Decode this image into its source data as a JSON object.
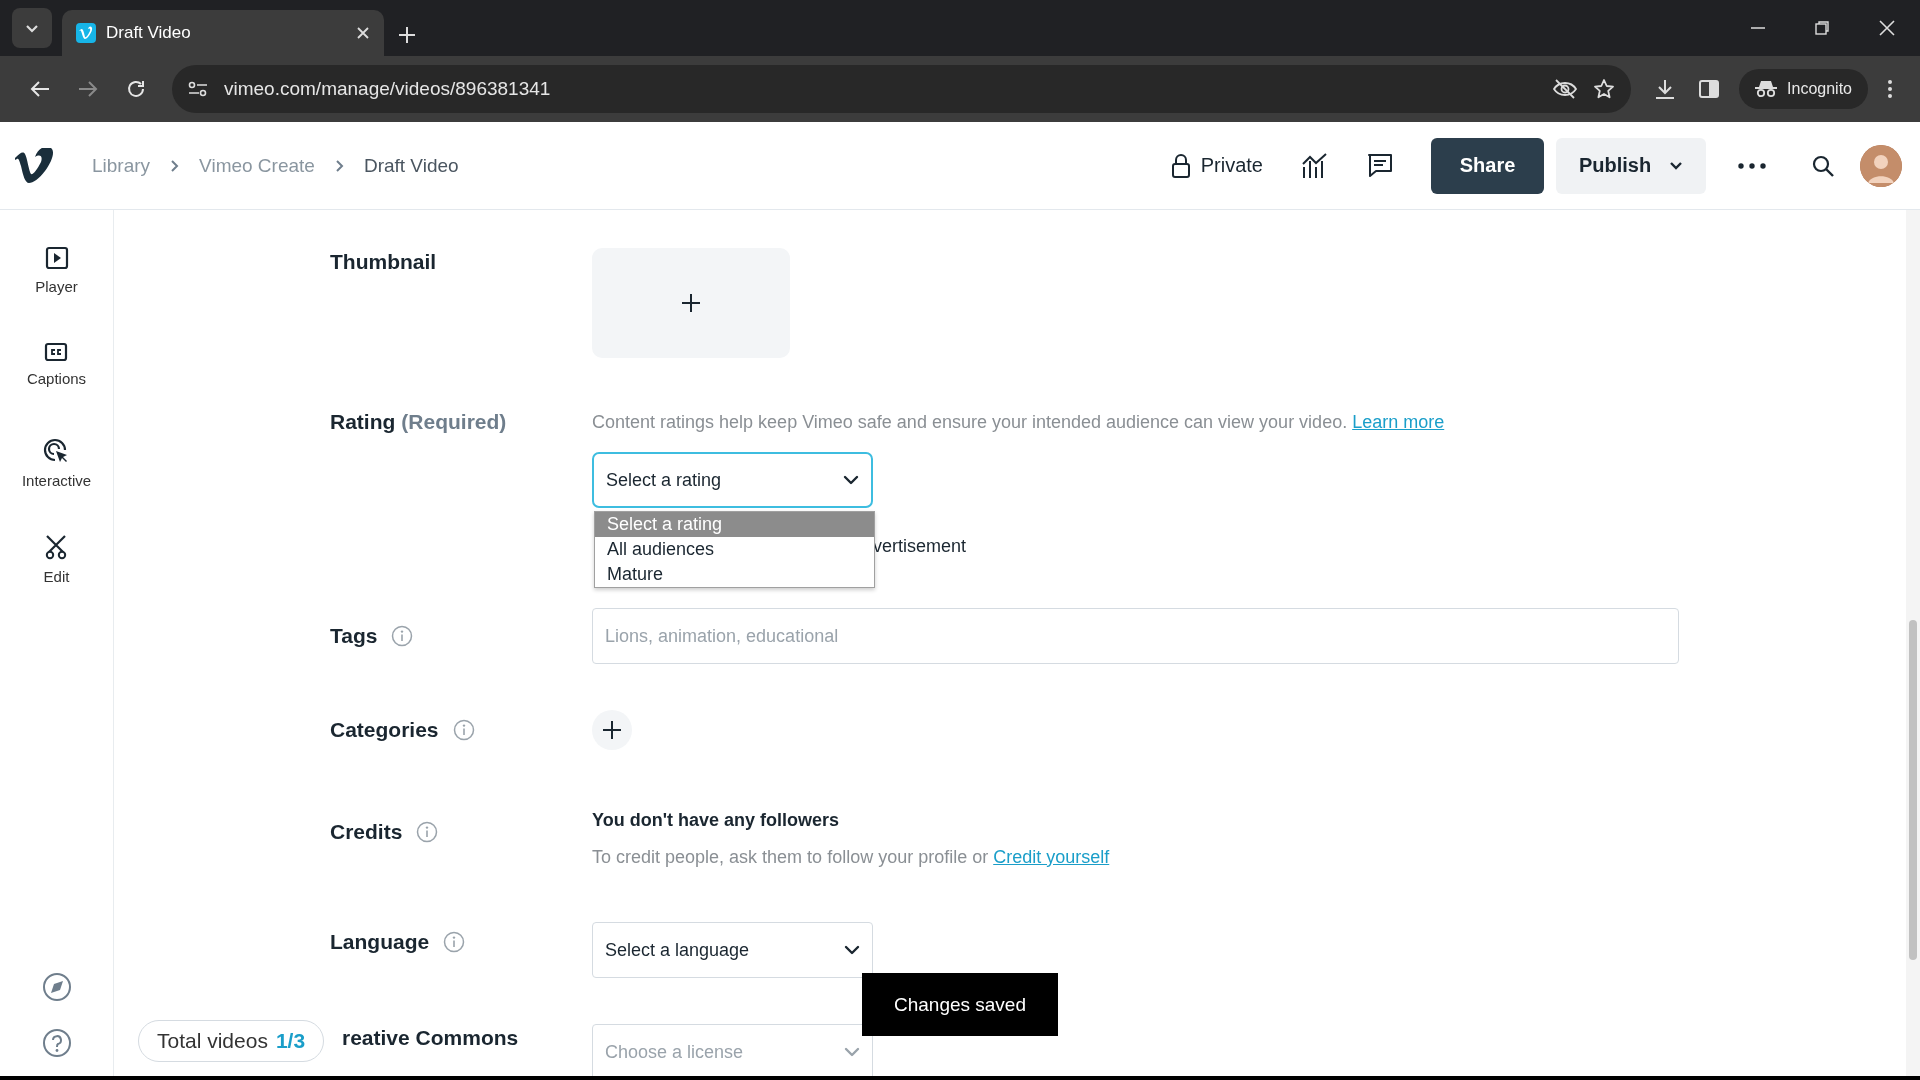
{
  "browser": {
    "tabs": [
      {
        "title": "Draft Video",
        "selected": true
      }
    ],
    "url": "vimeo.com/manage/videos/896381341",
    "profile_label": "Incognito"
  },
  "header": {
    "breadcrumbs": [
      {
        "label": "Library",
        "current": false
      },
      {
        "label": "Vimeo Create",
        "current": false
      },
      {
        "label": "Draft Video",
        "current": true
      }
    ],
    "privacy": "Private",
    "share": "Share",
    "publish": "Publish"
  },
  "sidebar": {
    "items": [
      {
        "label": "Player",
        "kind": "player"
      },
      {
        "label": "Captions",
        "kind": "captions"
      },
      {
        "label": "Interactive",
        "kind": "interactive"
      },
      {
        "label": "Edit",
        "kind": "edit"
      }
    ]
  },
  "form": {
    "thumbnail": {
      "label": "Thumbnail"
    },
    "rating": {
      "label": "Rating",
      "required_note": "(Required)",
      "description": "Content ratings help keep Vimeo safe and ensure your intended audience can view your video.",
      "link": "Learn more",
      "value": "Select a rating",
      "expanded": true,
      "options": [
        {
          "label": "Select a rating",
          "selected": true
        },
        {
          "label": "All audiences",
          "selected": false
        },
        {
          "label": "Mature",
          "selected": false
        }
      ],
      "hidden_checkbox_text": "vertisement"
    },
    "tags": {
      "label": "Tags",
      "placeholder": "Lions, animation, educational"
    },
    "categories": {
      "label": "Categories"
    },
    "credits": {
      "label": "Credits",
      "heading": "You don't have any followers",
      "text": "To credit people, ask them to follow your profile or",
      "link": "Credit yourself"
    },
    "language": {
      "label": "Language",
      "value": "Select a language"
    },
    "license": {
      "label": "reative Commons",
      "placeholder": "Choose a license"
    }
  },
  "total_videos": {
    "label": "Total videos",
    "count": "1/3"
  },
  "toast": "Changes saved"
}
